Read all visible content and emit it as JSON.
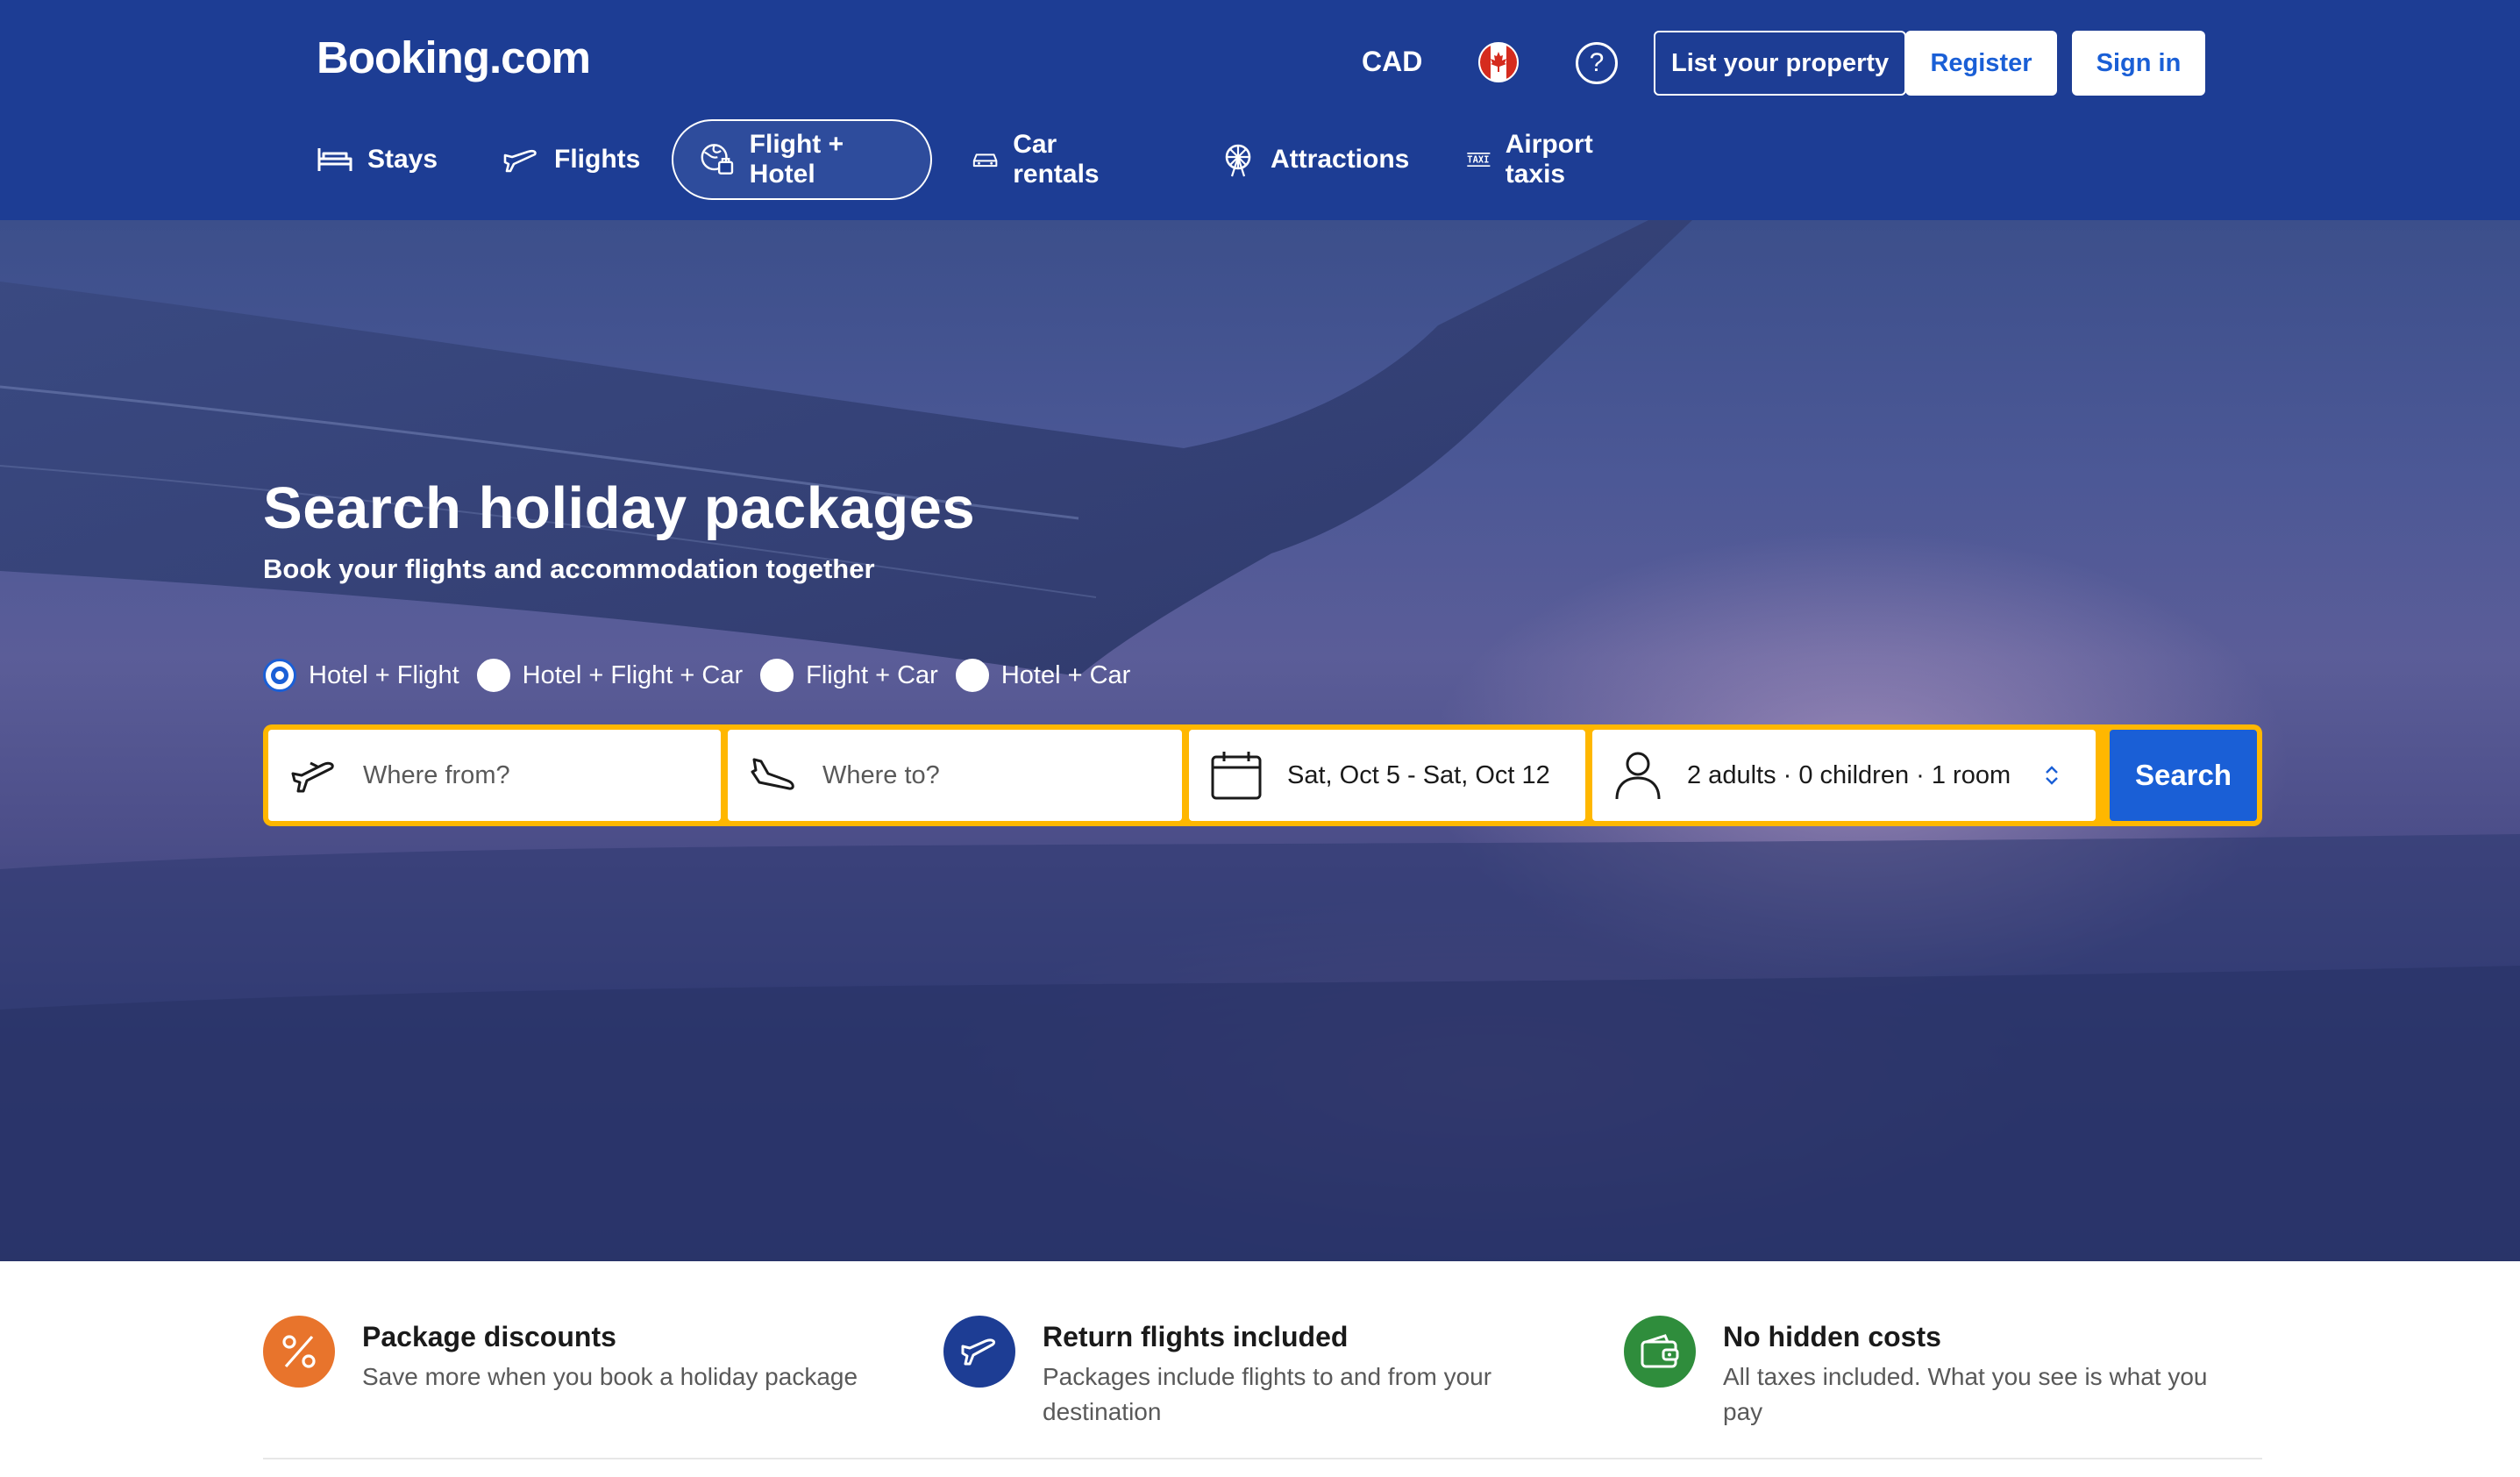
{
  "header": {
    "logo": "Booking.com",
    "currency": "CAD",
    "flag_icon": "canada-flag-icon",
    "help_icon": "question-icon",
    "list_property": "List your property",
    "register": "Register",
    "sign_in": "Sign in",
    "nav": [
      {
        "label": "Stays",
        "icon": "bed-icon",
        "active": false
      },
      {
        "label": "Flights",
        "icon": "plane-icon",
        "active": false
      },
      {
        "label": "Flight + Hotel",
        "icon": "globe-suitcase-icon",
        "active": true
      },
      {
        "label": "Car rentals",
        "icon": "car-icon",
        "active": false
      },
      {
        "label": "Attractions",
        "icon": "ferris-wheel-icon",
        "active": false
      },
      {
        "label": "Airport taxis",
        "icon": "taxi-icon",
        "active": false
      }
    ]
  },
  "hero": {
    "title": "Search holiday packages",
    "subtitle": "Book your flights and accommodation together",
    "package_types": [
      {
        "label": "Hotel + Flight",
        "checked": true
      },
      {
        "label": "Hotel + Flight + Car",
        "checked": false
      },
      {
        "label": "Flight + Car",
        "checked": false
      },
      {
        "label": "Hotel + Car",
        "checked": false
      }
    ],
    "search": {
      "from_placeholder": "Where from?",
      "to_placeholder": "Where to?",
      "dates": "Sat, Oct 5 - Sat, Oct 12",
      "occupancy": "2 adults · 0 children · 1 room",
      "button": "Search"
    }
  },
  "features": [
    {
      "title": "Package discounts",
      "desc": "Save more when you book a holiday package",
      "icon": "percent-icon",
      "color": "#e8742c"
    },
    {
      "title": "Return flights included",
      "desc": "Packages include flights to and from your destination",
      "icon": "plane-icon",
      "color": "#1d3d94"
    },
    {
      "title": "No hidden costs",
      "desc": "All taxes included. What you see is what you pay",
      "icon": "wallet-icon",
      "color": "#2f8d3c"
    }
  ],
  "colors": {
    "brand_blue": "#1d3d94",
    "accent_blue": "#1a5fd6",
    "search_border": "#ffb700"
  }
}
